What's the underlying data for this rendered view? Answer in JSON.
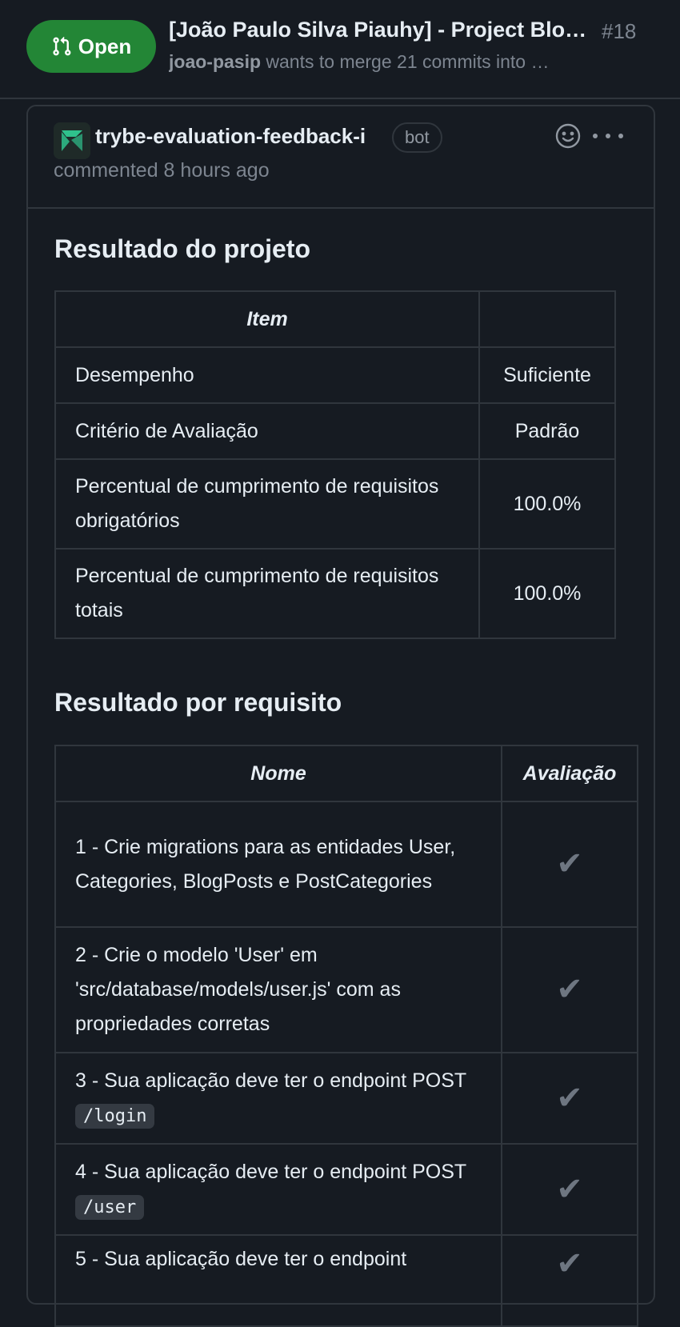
{
  "header": {
    "state": "Open",
    "title": "[João Paulo Silva Piauhy] - Project Blo…",
    "number": "#18",
    "author": "joao-pasip",
    "merge_text": " wants to merge 21 commits into …"
  },
  "comment": {
    "author": "trybe-evaluation-feedback-i",
    "badge": "bot",
    "meta": "commented 8 hours ago",
    "project_heading": "Resultado do projeto",
    "project_table": {
      "headers": [
        "Item",
        ""
      ],
      "rows": [
        {
          "item": "Desempenho",
          "value": "Suficiente"
        },
        {
          "item": "Critério de Avaliação",
          "value": "Padrão"
        },
        {
          "item": "Percentual de cumprimento de requisitos obrigatórios",
          "value": "100.0%"
        },
        {
          "item": "Percentual de cumprimento de requisitos totais",
          "value": "100.0%"
        }
      ]
    },
    "req_heading": "Resultado por requisito",
    "req_table": {
      "headers": [
        "Nome",
        "Avaliação"
      ],
      "rows": [
        {
          "text": "1 - Crie migrations para as entidades User, Categories, BlogPosts e PostCategories",
          "code": "",
          "mark": "✔"
        },
        {
          "text": "2 - Crie o modelo 'User' em 'src/database/models/user.js' com as propriedades corretas",
          "code": "",
          "mark": "✔"
        },
        {
          "text": "3 - Sua aplicação deve ter o endpoint POST ",
          "code": "/login",
          "mark": "✔"
        },
        {
          "text": "4 - Sua aplicação deve ter o endpoint POST ",
          "code": "/user",
          "mark": "✔"
        },
        {
          "text": "5 - Sua aplicação deve ter o endpoint",
          "code": "",
          "mark": "✔"
        }
      ]
    }
  }
}
